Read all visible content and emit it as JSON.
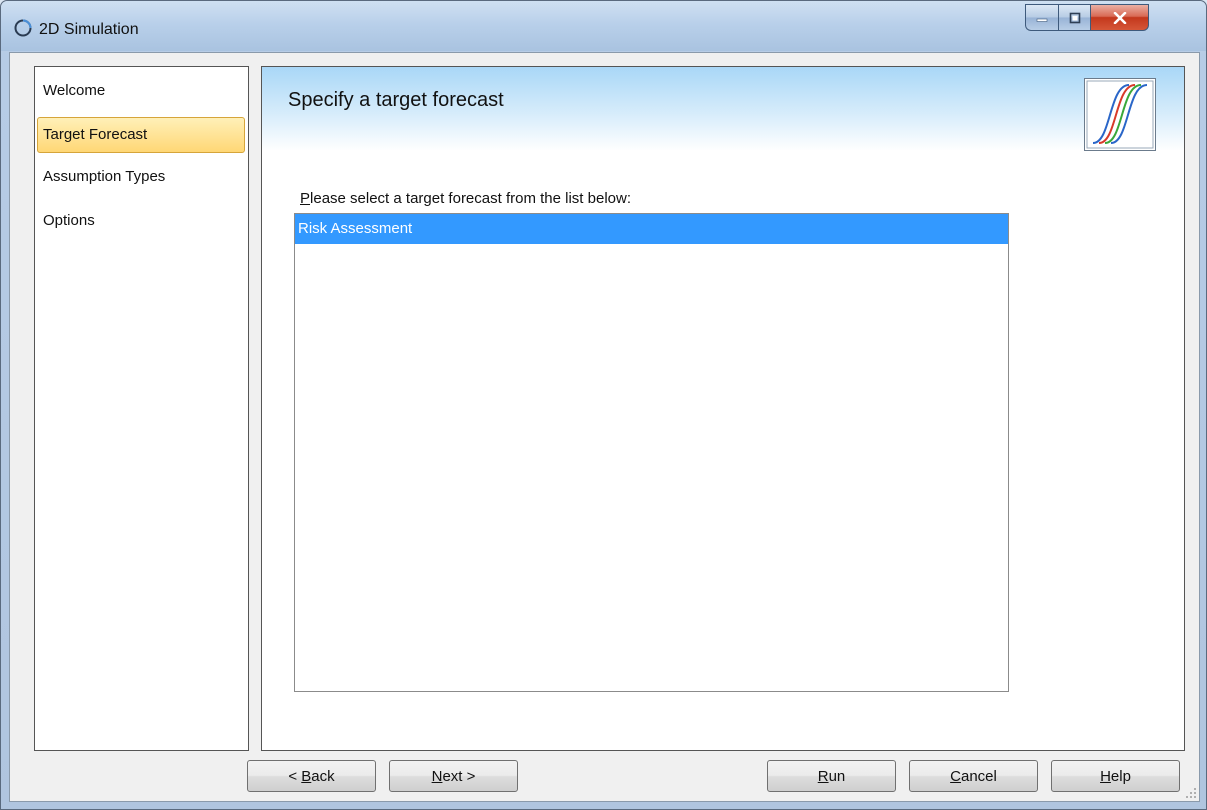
{
  "window": {
    "title": "2D Simulation",
    "controls": {
      "minimize": "minimize-icon",
      "maximize": "maximize-icon",
      "close": "close-icon"
    }
  },
  "nav": {
    "items": [
      {
        "label": "Welcome",
        "selected": false
      },
      {
        "label": "Target Forecast",
        "selected": true
      },
      {
        "label": "Assumption Types",
        "selected": false
      },
      {
        "label": "Options",
        "selected": false
      }
    ]
  },
  "panel": {
    "title": "Specify a target forecast",
    "image_icon": "sigmoid-curves-icon",
    "list_label_accel": "P",
    "list_label_rest": "lease select a target forecast from the list below:",
    "forecasts": [
      {
        "label": "Risk Assessment",
        "selected": true
      }
    ]
  },
  "buttons": {
    "back": {
      "prefix": "< ",
      "accel": "B",
      "rest": "ack"
    },
    "next": {
      "prefix": "",
      "accel": "N",
      "rest": "ext >"
    },
    "run": {
      "prefix": "",
      "accel": "R",
      "rest": "un"
    },
    "cancel": {
      "prefix": "",
      "accel": "C",
      "rest": "ancel"
    },
    "help": {
      "prefix": "",
      "accel": "H",
      "rest": "elp"
    }
  },
  "colors": {
    "selection": "#3399ff",
    "nav_selected": "#ffd775",
    "header_gradient_top": "#a9d7f7"
  }
}
